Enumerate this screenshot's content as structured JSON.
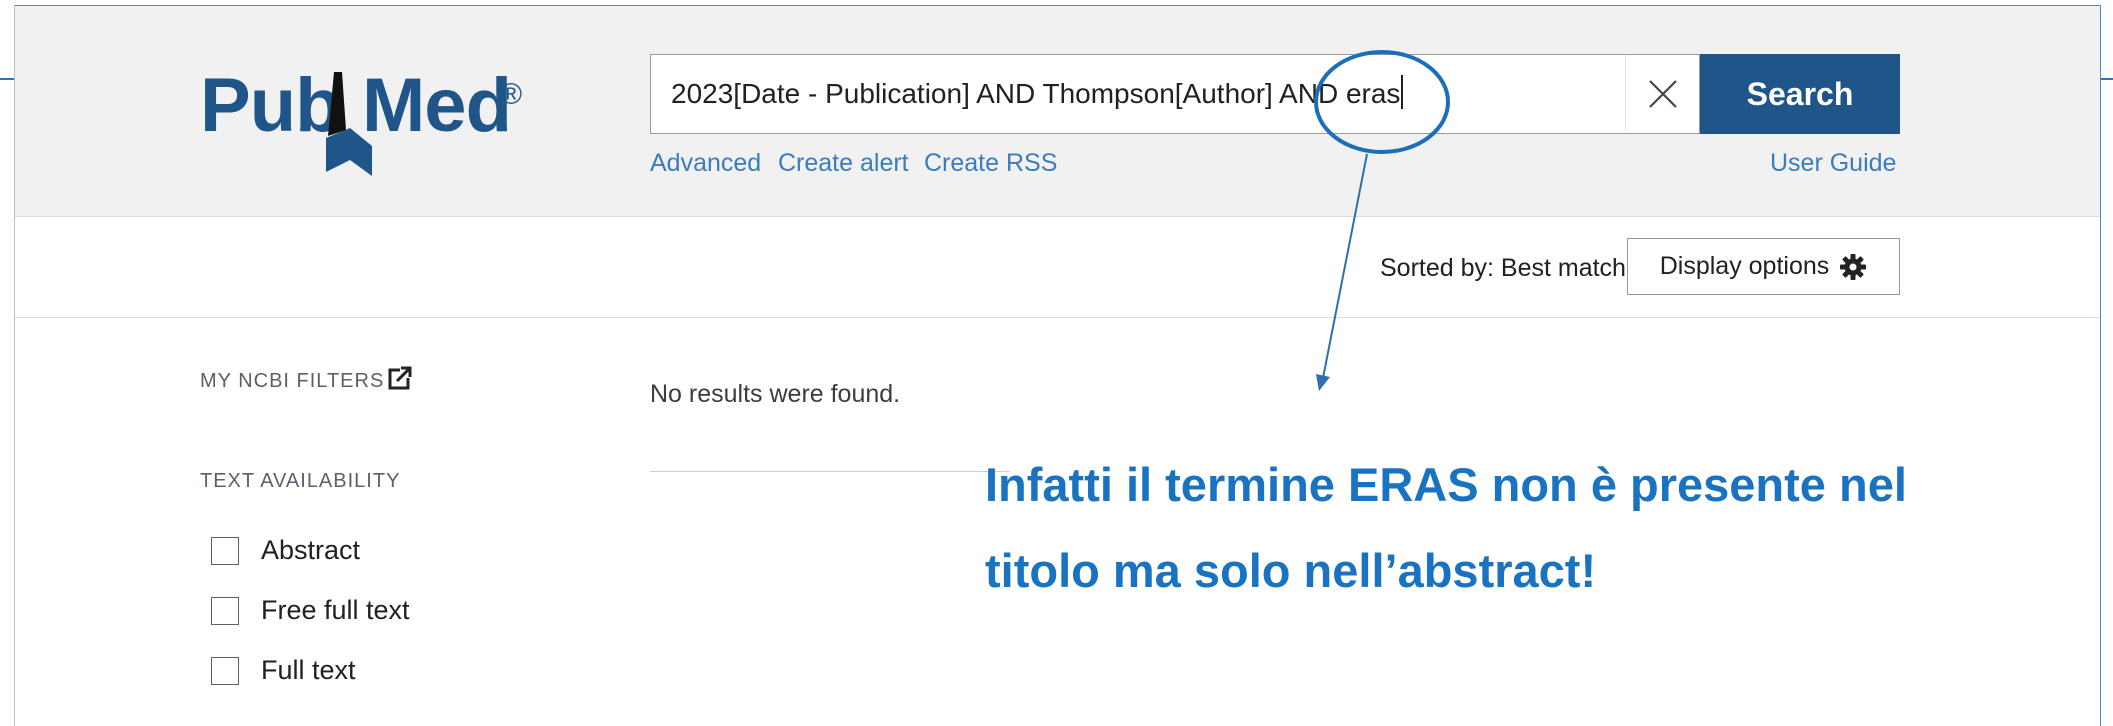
{
  "logo": {
    "pub": "Pub",
    "med": "Med",
    "reg": "®"
  },
  "search": {
    "query": "2023[Date - Publication] AND Thompson[Author] AND eras",
    "button_label": "Search"
  },
  "links": {
    "advanced": "Advanced",
    "create_alert": "Create alert",
    "create_rss": "Create RSS",
    "user_guide": "User Guide"
  },
  "sort": {
    "sorted_by": "Sorted by: Best match",
    "display_options": "Display options"
  },
  "sidebar": {
    "my_ncbi_filters": "MY NCBI FILTERS",
    "text_availability": "TEXT AVAILABILITY",
    "filters": [
      {
        "label": "Abstract"
      },
      {
        "label": "Free full text"
      },
      {
        "label": "Full text"
      }
    ]
  },
  "results": {
    "message": "No results were found."
  },
  "annotation": {
    "line1": "Infatti il termine ERAS non è presente nel",
    "line2": "titolo ma solo nell’abstract!"
  },
  "colors": {
    "brand": "#20558a",
    "link": "#3b7bbf",
    "annotation": "#1a73c1",
    "header_bg": "#f1f1f1"
  },
  "icons": [
    "close-icon",
    "gear-icon",
    "external-link-icon"
  ]
}
